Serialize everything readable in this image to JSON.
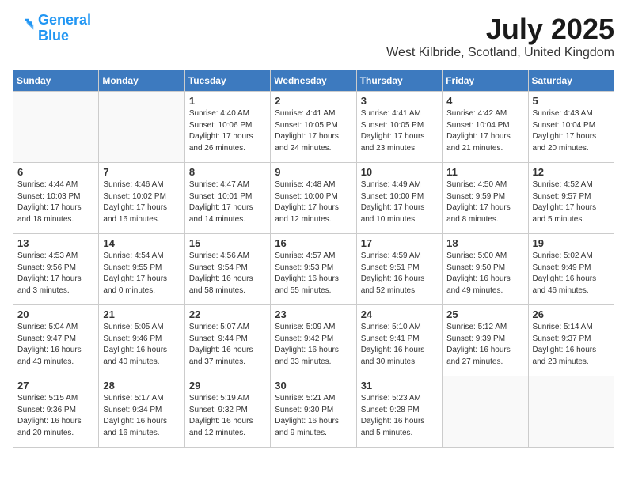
{
  "header": {
    "logo_line1": "General",
    "logo_line2": "Blue",
    "month": "July 2025",
    "location": "West Kilbride, Scotland, United Kingdom"
  },
  "weekdays": [
    "Sunday",
    "Monday",
    "Tuesday",
    "Wednesday",
    "Thursday",
    "Friday",
    "Saturday"
  ],
  "weeks": [
    [
      {
        "day": null
      },
      {
        "day": null
      },
      {
        "day": "1",
        "sunrise": "4:40 AM",
        "sunset": "10:06 PM",
        "daylight": "17 hours and 26 minutes."
      },
      {
        "day": "2",
        "sunrise": "4:41 AM",
        "sunset": "10:05 PM",
        "daylight": "17 hours and 24 minutes."
      },
      {
        "day": "3",
        "sunrise": "4:41 AM",
        "sunset": "10:05 PM",
        "daylight": "17 hours and 23 minutes."
      },
      {
        "day": "4",
        "sunrise": "4:42 AM",
        "sunset": "10:04 PM",
        "daylight": "17 hours and 21 minutes."
      },
      {
        "day": "5",
        "sunrise": "4:43 AM",
        "sunset": "10:04 PM",
        "daylight": "17 hours and 20 minutes."
      }
    ],
    [
      {
        "day": "6",
        "sunrise": "4:44 AM",
        "sunset": "10:03 PM",
        "daylight": "17 hours and 18 minutes."
      },
      {
        "day": "7",
        "sunrise": "4:46 AM",
        "sunset": "10:02 PM",
        "daylight": "17 hours and 16 minutes."
      },
      {
        "day": "8",
        "sunrise": "4:47 AM",
        "sunset": "10:01 PM",
        "daylight": "17 hours and 14 minutes."
      },
      {
        "day": "9",
        "sunrise": "4:48 AM",
        "sunset": "10:00 PM",
        "daylight": "17 hours and 12 minutes."
      },
      {
        "day": "10",
        "sunrise": "4:49 AM",
        "sunset": "10:00 PM",
        "daylight": "17 hours and 10 minutes."
      },
      {
        "day": "11",
        "sunrise": "4:50 AM",
        "sunset": "9:59 PM",
        "daylight": "17 hours and 8 minutes."
      },
      {
        "day": "12",
        "sunrise": "4:52 AM",
        "sunset": "9:57 PM",
        "daylight": "17 hours and 5 minutes."
      }
    ],
    [
      {
        "day": "13",
        "sunrise": "4:53 AM",
        "sunset": "9:56 PM",
        "daylight": "17 hours and 3 minutes."
      },
      {
        "day": "14",
        "sunrise": "4:54 AM",
        "sunset": "9:55 PM",
        "daylight": "17 hours and 0 minutes."
      },
      {
        "day": "15",
        "sunrise": "4:56 AM",
        "sunset": "9:54 PM",
        "daylight": "16 hours and 58 minutes."
      },
      {
        "day": "16",
        "sunrise": "4:57 AM",
        "sunset": "9:53 PM",
        "daylight": "16 hours and 55 minutes."
      },
      {
        "day": "17",
        "sunrise": "4:59 AM",
        "sunset": "9:51 PM",
        "daylight": "16 hours and 52 minutes."
      },
      {
        "day": "18",
        "sunrise": "5:00 AM",
        "sunset": "9:50 PM",
        "daylight": "16 hours and 49 minutes."
      },
      {
        "day": "19",
        "sunrise": "5:02 AM",
        "sunset": "9:49 PM",
        "daylight": "16 hours and 46 minutes."
      }
    ],
    [
      {
        "day": "20",
        "sunrise": "5:04 AM",
        "sunset": "9:47 PM",
        "daylight": "16 hours and 43 minutes."
      },
      {
        "day": "21",
        "sunrise": "5:05 AM",
        "sunset": "9:46 PM",
        "daylight": "16 hours and 40 minutes."
      },
      {
        "day": "22",
        "sunrise": "5:07 AM",
        "sunset": "9:44 PM",
        "daylight": "16 hours and 37 minutes."
      },
      {
        "day": "23",
        "sunrise": "5:09 AM",
        "sunset": "9:42 PM",
        "daylight": "16 hours and 33 minutes."
      },
      {
        "day": "24",
        "sunrise": "5:10 AM",
        "sunset": "9:41 PM",
        "daylight": "16 hours and 30 minutes."
      },
      {
        "day": "25",
        "sunrise": "5:12 AM",
        "sunset": "9:39 PM",
        "daylight": "16 hours and 27 minutes."
      },
      {
        "day": "26",
        "sunrise": "5:14 AM",
        "sunset": "9:37 PM",
        "daylight": "16 hours and 23 minutes."
      }
    ],
    [
      {
        "day": "27",
        "sunrise": "5:15 AM",
        "sunset": "9:36 PM",
        "daylight": "16 hours and 20 minutes."
      },
      {
        "day": "28",
        "sunrise": "5:17 AM",
        "sunset": "9:34 PM",
        "daylight": "16 hours and 16 minutes."
      },
      {
        "day": "29",
        "sunrise": "5:19 AM",
        "sunset": "9:32 PM",
        "daylight": "16 hours and 12 minutes."
      },
      {
        "day": "30",
        "sunrise": "5:21 AM",
        "sunset": "9:30 PM",
        "daylight": "16 hours and 9 minutes."
      },
      {
        "day": "31",
        "sunrise": "5:23 AM",
        "sunset": "9:28 PM",
        "daylight": "16 hours and 5 minutes."
      },
      {
        "day": null
      },
      {
        "day": null
      }
    ]
  ],
  "labels": {
    "sunrise_prefix": "Sunrise:",
    "sunset_prefix": "Sunset:",
    "daylight_prefix": "Daylight:"
  }
}
